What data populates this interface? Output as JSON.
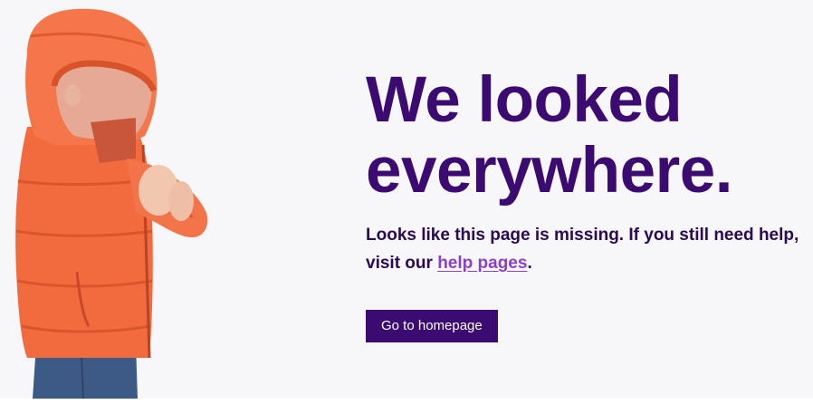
{
  "headline": {
    "line1": "We looked",
    "line2": "everywhere."
  },
  "message": {
    "text_before_link": "Looks like this page is missing. If you still need help, visit our ",
    "link_label": "help pages",
    "text_after_link": "."
  },
  "home_button": {
    "label": "Go to homepage"
  },
  "colors": {
    "brand_purple": "#3b0b72",
    "link_purple": "#8a3fd1",
    "page_background": "#f7f7f9",
    "jacket_orange": "#f26b3f"
  },
  "image": {
    "subject": "child-in-orange-puffer-jacket"
  }
}
